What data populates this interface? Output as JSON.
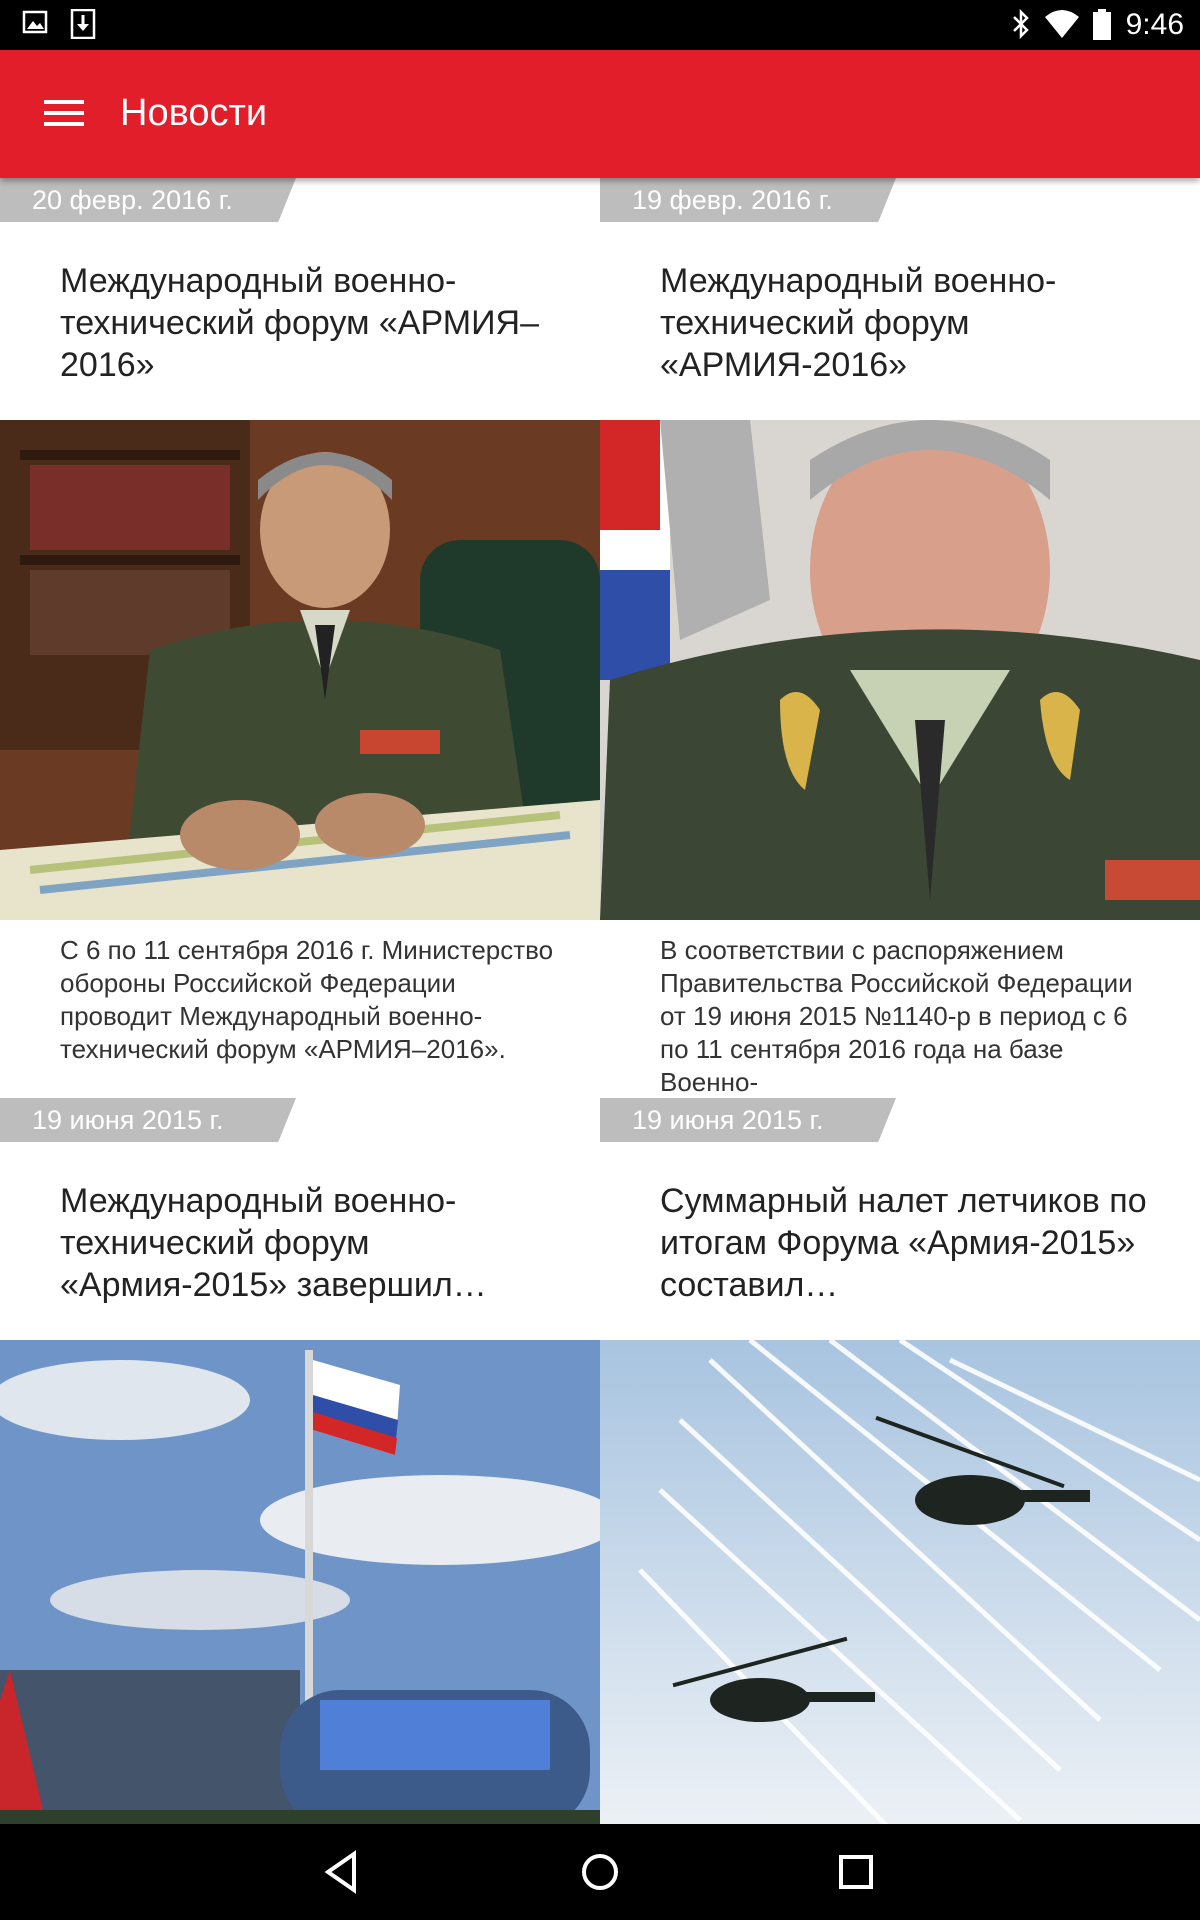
{
  "status_bar": {
    "time": "9:46"
  },
  "app_bar": {
    "title": "Новости"
  },
  "news": [
    {
      "date": "20 февр. 2016 г.",
      "title": "Международный военно-технический форум «АРМИЯ–2016»",
      "summary": "С 6 по 11 сентября 2016 г. Министерство обороны Российской Федерации проводит Международный военно-технический форум «АРМИЯ–2016»."
    },
    {
      "date": "19 февр. 2016 г.",
      "title": "Международный военно-технический форум «АРМИЯ-2016»",
      "summary": "В соответствии с распоряжением Правительства Российской Федерации от 19 июня 2015 №1140-р в период с 6 по 11 сентября 2016 года на базе Военно-"
    },
    {
      "date": "19 июня 2015 г.",
      "title": "Международный военно-технический форум «Армия-2015» завершил…",
      "summary": ""
    },
    {
      "date": "19 июня 2015 г.",
      "title": "Суммарный налет летчиков по итогам Форума «Армия-2015» составил…",
      "summary": ""
    }
  ],
  "colors": {
    "accent": "#e21e2b",
    "date_tag": "#bdbdbd"
  },
  "icons": [
    "image-icon",
    "download-icon",
    "bluetooth-icon",
    "wifi-icon",
    "battery-icon",
    "menu-icon",
    "back-icon",
    "home-icon",
    "recents-icon"
  ]
}
